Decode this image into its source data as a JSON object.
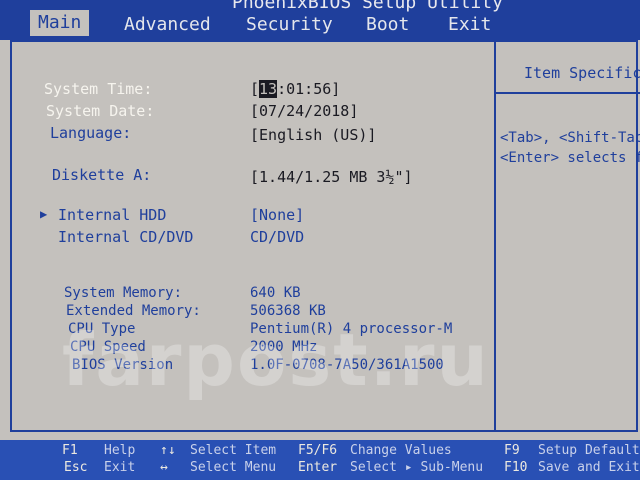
{
  "window": {
    "title": "PhoenixBIOS Setup Utility"
  },
  "menu": {
    "tabs": [
      {
        "label": "Main",
        "active": true
      },
      {
        "label": "Advanced"
      },
      {
        "label": "Security"
      },
      {
        "label": "Boot"
      },
      {
        "label": "Exit"
      }
    ]
  },
  "main": {
    "system_time": {
      "label": "System Time:",
      "value_cursor": "13",
      "value_rest": ":01:56]",
      "value_open": "["
    },
    "system_date": {
      "label": "System Date:",
      "value": "[07/24/2018]"
    },
    "language": {
      "label": "Language:",
      "value": "[English  (US)]"
    },
    "diskette_a": {
      "label": "Diskette A:",
      "value": "[1.44/1.25 MB  3½\"]"
    },
    "internal_hdd": {
      "label": "Internal HDD",
      "value": "[None]"
    },
    "internal_cd": {
      "label": "Internal CD/DVD",
      "value": "CD/DVD"
    },
    "system_memory": {
      "label": "System Memory:",
      "value": "640 KB"
    },
    "extended_memory": {
      "label": "Extended Memory:",
      "value": "506368 KB"
    },
    "cpu_type": {
      "label": "CPU Type",
      "value": "Pentium(R) 4 processor-M"
    },
    "cpu_speed": {
      "label": "CPU Speed",
      "value": "2000 MHz"
    },
    "bios_version": {
      "label": "BIOS Version",
      "value": "1.0F-0708-7A50/361A1500"
    }
  },
  "help": {
    "title": "Item Specific",
    "lines": [
      "<Tab>, <Shift-Tab",
      "<Enter> selects f"
    ]
  },
  "footer": {
    "row1": [
      {
        "key": "F1",
        "desc": "Help"
      },
      {
        "key": "↑↓",
        "desc": "Select Item"
      },
      {
        "key": "F5/F6",
        "desc": "Change Values"
      },
      {
        "key": "F9",
        "desc": "Setup Defaults"
      }
    ],
    "row2": [
      {
        "key": "Esc",
        "desc": "Exit"
      },
      {
        "key": "↔",
        "desc": "Select Menu"
      },
      {
        "key": "Enter",
        "desc": "Select ▸ Sub-Menu"
      },
      {
        "key": "F10",
        "desc": "Save and Exit"
      }
    ]
  },
  "watermark": "farpost.ru",
  "colors": {
    "bios_blue": "#1f3f9c",
    "panel_grey": "#c4c1bd",
    "footer_blue": "#2950b4",
    "highlight_white": "#f6f4ee"
  }
}
